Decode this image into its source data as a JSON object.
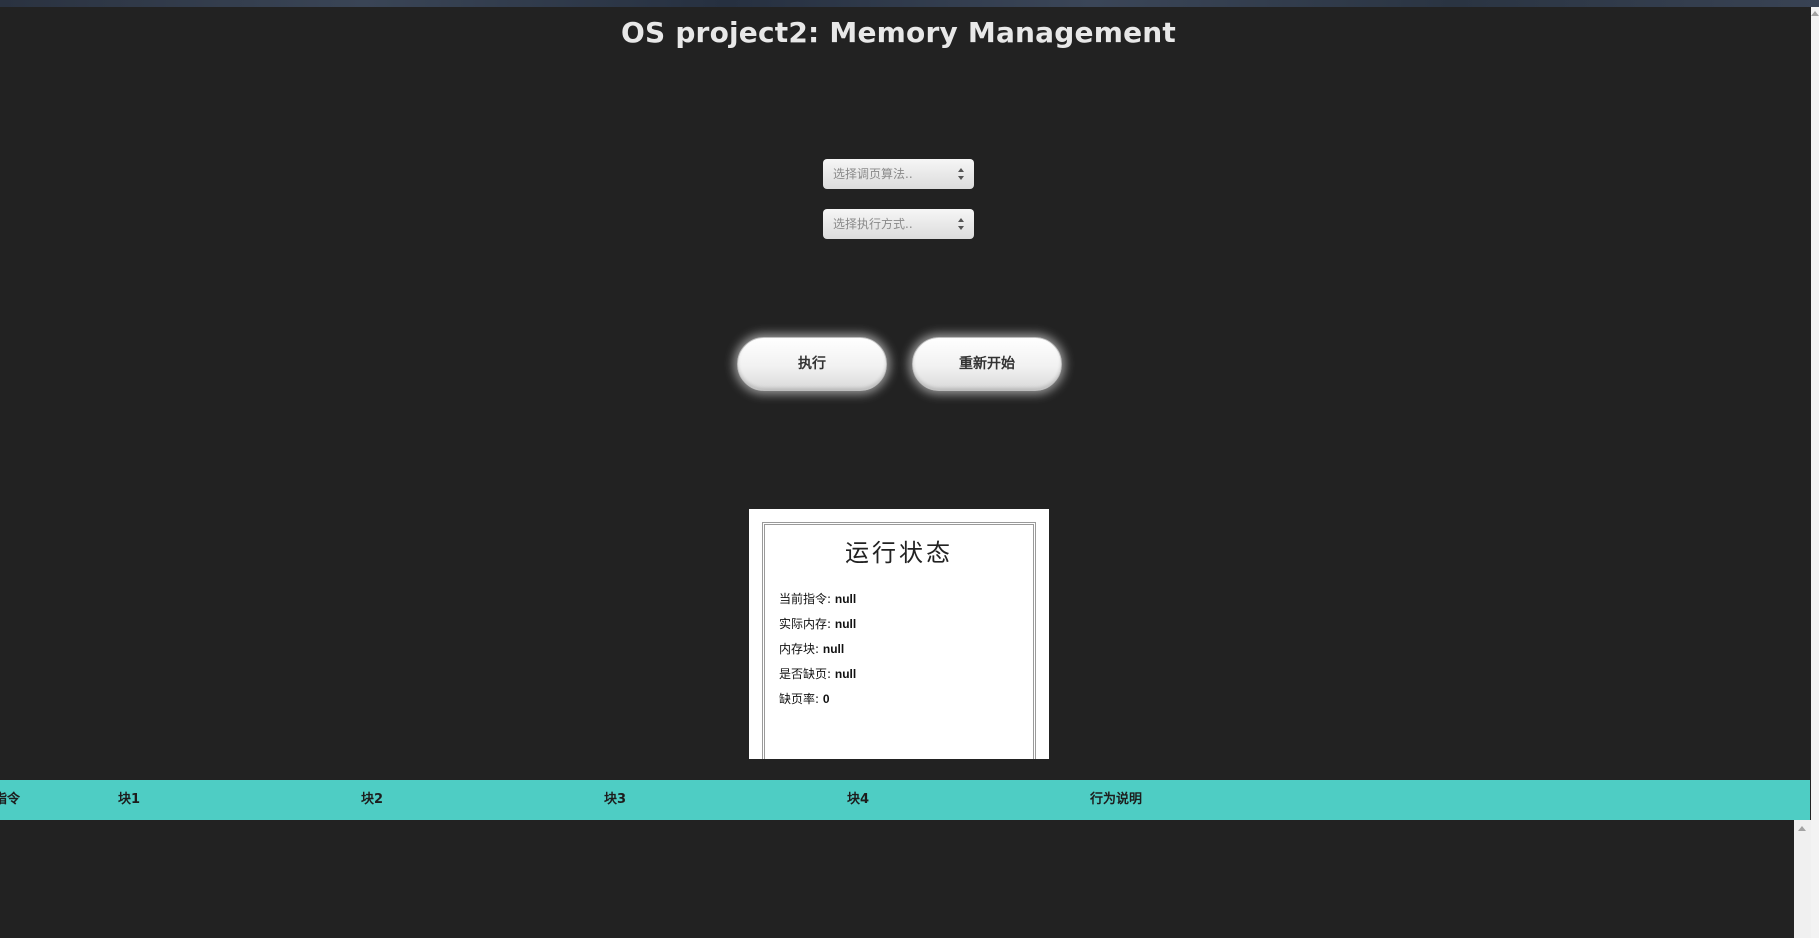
{
  "page": {
    "title": "OS project2: Memory Management"
  },
  "controls": {
    "algorithm_select": {
      "placeholder": "选择调页算法..",
      "value": "选择调页算法.."
    },
    "mode_select": {
      "placeholder": "选择执行方式..",
      "value": "选择执行方式.."
    },
    "execute_label": "执行",
    "restart_label": "重新开始"
  },
  "status": {
    "title": "运行状态",
    "rows": [
      {
        "label": "当前指令:",
        "value": "null"
      },
      {
        "label": "实际内存:",
        "value": "null"
      },
      {
        "label": "内存块:",
        "value": "null"
      },
      {
        "label": "是否缺页:",
        "value": "null"
      },
      {
        "label": "缺页率:",
        "value": "0"
      }
    ]
  },
  "table": {
    "headers": [
      "指令",
      "块1",
      "块2",
      "块3",
      "块4",
      "行为说明"
    ]
  },
  "colors": {
    "background": "#222222",
    "table_header": "#4ecdc4",
    "title_text": "#e8e8e8"
  },
  "icons": {
    "select_arrows": "up-down-arrows-icon",
    "scroll_up": "scroll-up-arrow-icon"
  }
}
